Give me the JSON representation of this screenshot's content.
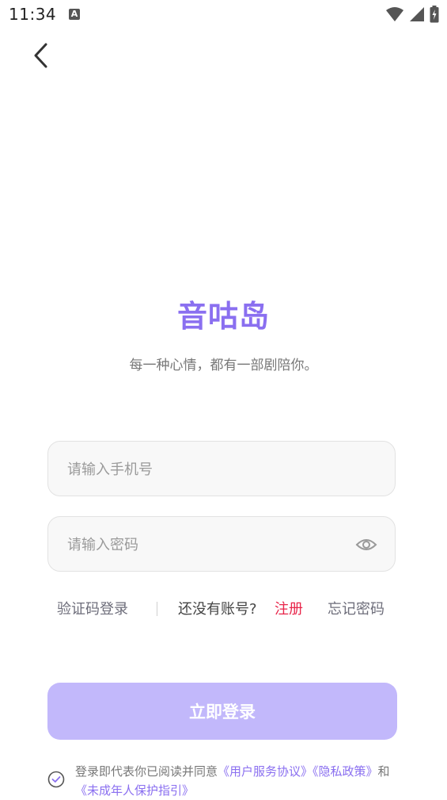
{
  "status_bar": {
    "time": "11:34",
    "notification_badge": "A",
    "icons": [
      "wifi-icon",
      "signal-icon",
      "battery-charging-icon"
    ]
  },
  "nav": {
    "back_icon": "chevron-left-icon"
  },
  "brand": {
    "title": "音咕岛",
    "slogan": "每一种心情，都有一部剧陪你。"
  },
  "form": {
    "phone_placeholder": "请输入手机号",
    "phone_value": "",
    "password_placeholder": "请输入密码",
    "password_value": "",
    "eye_icon": "eye-icon"
  },
  "links": {
    "sms_login": "验证码登录",
    "no_account": "还没有账号?",
    "register": "注册",
    "forgot_password": "忘记密码"
  },
  "login_button": "立即登录",
  "agreement": {
    "checked": true,
    "prefix": "登录即代表你已阅读并同意",
    "user_agreement": "《用户服务协议》",
    "privacy_policy": "《隐私政策》",
    "and": "和",
    "minor_guide": "《未成年人保护指引》"
  },
  "colors": {
    "brand": "#8a6ff0",
    "register_link": "#e8254a",
    "login_button_bg": "#c2b8fb"
  }
}
